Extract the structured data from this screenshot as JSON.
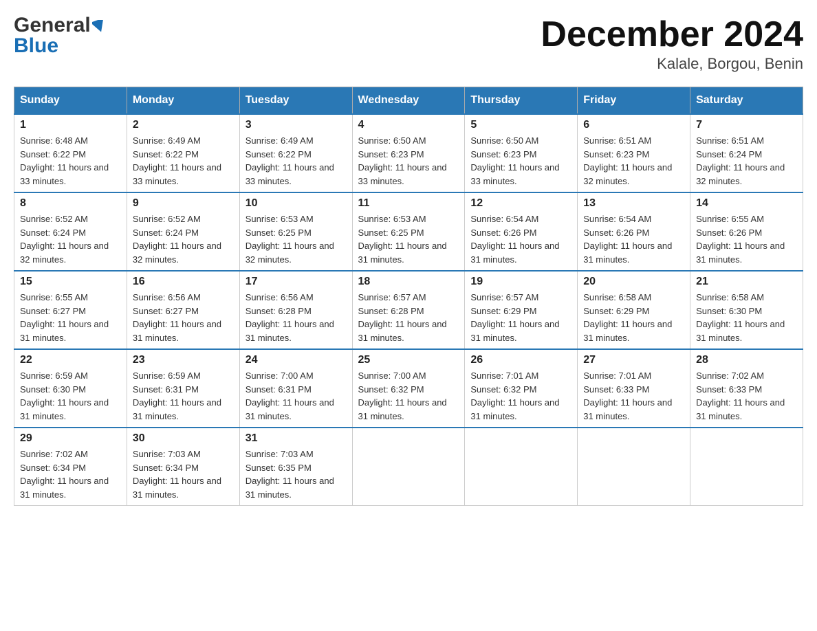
{
  "header": {
    "logo_general": "General",
    "logo_blue": "Blue",
    "month_title": "December 2024",
    "location": "Kalale, Borgou, Benin"
  },
  "days_of_week": [
    "Sunday",
    "Monday",
    "Tuesday",
    "Wednesday",
    "Thursday",
    "Friday",
    "Saturday"
  ],
  "weeks": [
    [
      {
        "day": "1",
        "sunrise": "6:48 AM",
        "sunset": "6:22 PM",
        "daylight": "11 hours and 33 minutes."
      },
      {
        "day": "2",
        "sunrise": "6:49 AM",
        "sunset": "6:22 PM",
        "daylight": "11 hours and 33 minutes."
      },
      {
        "day": "3",
        "sunrise": "6:49 AM",
        "sunset": "6:22 PM",
        "daylight": "11 hours and 33 minutes."
      },
      {
        "day": "4",
        "sunrise": "6:50 AM",
        "sunset": "6:23 PM",
        "daylight": "11 hours and 33 minutes."
      },
      {
        "day": "5",
        "sunrise": "6:50 AM",
        "sunset": "6:23 PM",
        "daylight": "11 hours and 33 minutes."
      },
      {
        "day": "6",
        "sunrise": "6:51 AM",
        "sunset": "6:23 PM",
        "daylight": "11 hours and 32 minutes."
      },
      {
        "day": "7",
        "sunrise": "6:51 AM",
        "sunset": "6:24 PM",
        "daylight": "11 hours and 32 minutes."
      }
    ],
    [
      {
        "day": "8",
        "sunrise": "6:52 AM",
        "sunset": "6:24 PM",
        "daylight": "11 hours and 32 minutes."
      },
      {
        "day": "9",
        "sunrise": "6:52 AM",
        "sunset": "6:24 PM",
        "daylight": "11 hours and 32 minutes."
      },
      {
        "day": "10",
        "sunrise": "6:53 AM",
        "sunset": "6:25 PM",
        "daylight": "11 hours and 32 minutes."
      },
      {
        "day": "11",
        "sunrise": "6:53 AM",
        "sunset": "6:25 PM",
        "daylight": "11 hours and 31 minutes."
      },
      {
        "day": "12",
        "sunrise": "6:54 AM",
        "sunset": "6:26 PM",
        "daylight": "11 hours and 31 minutes."
      },
      {
        "day": "13",
        "sunrise": "6:54 AM",
        "sunset": "6:26 PM",
        "daylight": "11 hours and 31 minutes."
      },
      {
        "day": "14",
        "sunrise": "6:55 AM",
        "sunset": "6:26 PM",
        "daylight": "11 hours and 31 minutes."
      }
    ],
    [
      {
        "day": "15",
        "sunrise": "6:55 AM",
        "sunset": "6:27 PM",
        "daylight": "11 hours and 31 minutes."
      },
      {
        "day": "16",
        "sunrise": "6:56 AM",
        "sunset": "6:27 PM",
        "daylight": "11 hours and 31 minutes."
      },
      {
        "day": "17",
        "sunrise": "6:56 AM",
        "sunset": "6:28 PM",
        "daylight": "11 hours and 31 minutes."
      },
      {
        "day": "18",
        "sunrise": "6:57 AM",
        "sunset": "6:28 PM",
        "daylight": "11 hours and 31 minutes."
      },
      {
        "day": "19",
        "sunrise": "6:57 AM",
        "sunset": "6:29 PM",
        "daylight": "11 hours and 31 minutes."
      },
      {
        "day": "20",
        "sunrise": "6:58 AM",
        "sunset": "6:29 PM",
        "daylight": "11 hours and 31 minutes."
      },
      {
        "day": "21",
        "sunrise": "6:58 AM",
        "sunset": "6:30 PM",
        "daylight": "11 hours and 31 minutes."
      }
    ],
    [
      {
        "day": "22",
        "sunrise": "6:59 AM",
        "sunset": "6:30 PM",
        "daylight": "11 hours and 31 minutes."
      },
      {
        "day": "23",
        "sunrise": "6:59 AM",
        "sunset": "6:31 PM",
        "daylight": "11 hours and 31 minutes."
      },
      {
        "day": "24",
        "sunrise": "7:00 AM",
        "sunset": "6:31 PM",
        "daylight": "11 hours and 31 minutes."
      },
      {
        "day": "25",
        "sunrise": "7:00 AM",
        "sunset": "6:32 PM",
        "daylight": "11 hours and 31 minutes."
      },
      {
        "day": "26",
        "sunrise": "7:01 AM",
        "sunset": "6:32 PM",
        "daylight": "11 hours and 31 minutes."
      },
      {
        "day": "27",
        "sunrise": "7:01 AM",
        "sunset": "6:33 PM",
        "daylight": "11 hours and 31 minutes."
      },
      {
        "day": "28",
        "sunrise": "7:02 AM",
        "sunset": "6:33 PM",
        "daylight": "11 hours and 31 minutes."
      }
    ],
    [
      {
        "day": "29",
        "sunrise": "7:02 AM",
        "sunset": "6:34 PM",
        "daylight": "11 hours and 31 minutes."
      },
      {
        "day": "30",
        "sunrise": "7:03 AM",
        "sunset": "6:34 PM",
        "daylight": "11 hours and 31 minutes."
      },
      {
        "day": "31",
        "sunrise": "7:03 AM",
        "sunset": "6:35 PM",
        "daylight": "11 hours and 31 minutes."
      },
      null,
      null,
      null,
      null
    ]
  ]
}
